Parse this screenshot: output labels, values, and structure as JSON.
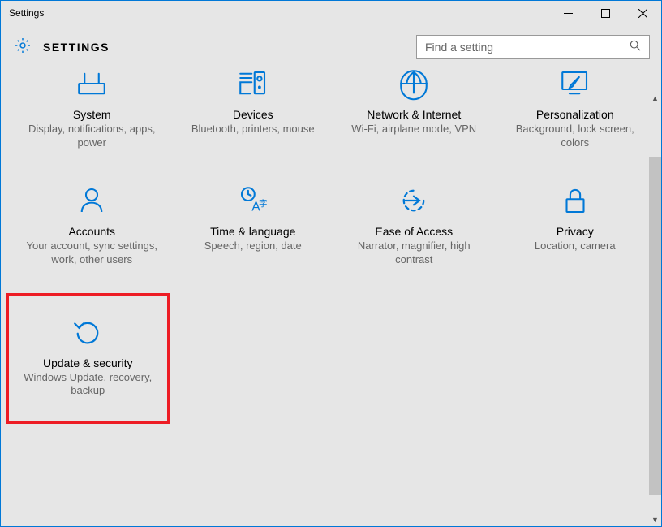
{
  "window": {
    "title": "Settings"
  },
  "header": {
    "title": "SETTINGS",
    "search_placeholder": "Find a setting"
  },
  "tiles": {
    "system": {
      "title": "System",
      "desc": "Display, notifications, apps, power",
      "icon": "system-icon"
    },
    "devices": {
      "title": "Devices",
      "desc": "Bluetooth, printers, mouse",
      "icon": "devices-icon"
    },
    "network": {
      "title": "Network & Internet",
      "desc": "Wi-Fi, airplane mode, VPN",
      "icon": "network-icon"
    },
    "personalization": {
      "title": "Personalization",
      "desc": "Background, lock screen, colors",
      "icon": "personalization-icon"
    },
    "accounts": {
      "title": "Accounts",
      "desc": "Your account, sync settings, work, other users",
      "icon": "accounts-icon"
    },
    "time": {
      "title": "Time & language",
      "desc": "Speech, region, date",
      "icon": "time-icon"
    },
    "ease": {
      "title": "Ease of Access",
      "desc": "Narrator, magnifier, high contrast",
      "icon": "ease-icon"
    },
    "privacy": {
      "title": "Privacy",
      "desc": "Location, camera",
      "icon": "privacy-icon"
    },
    "update": {
      "title": "Update & security",
      "desc": "Windows Update, recovery, backup",
      "icon": "update-icon"
    }
  },
  "colors": {
    "accent": "#0078d7",
    "highlight": "#ed1c24"
  }
}
